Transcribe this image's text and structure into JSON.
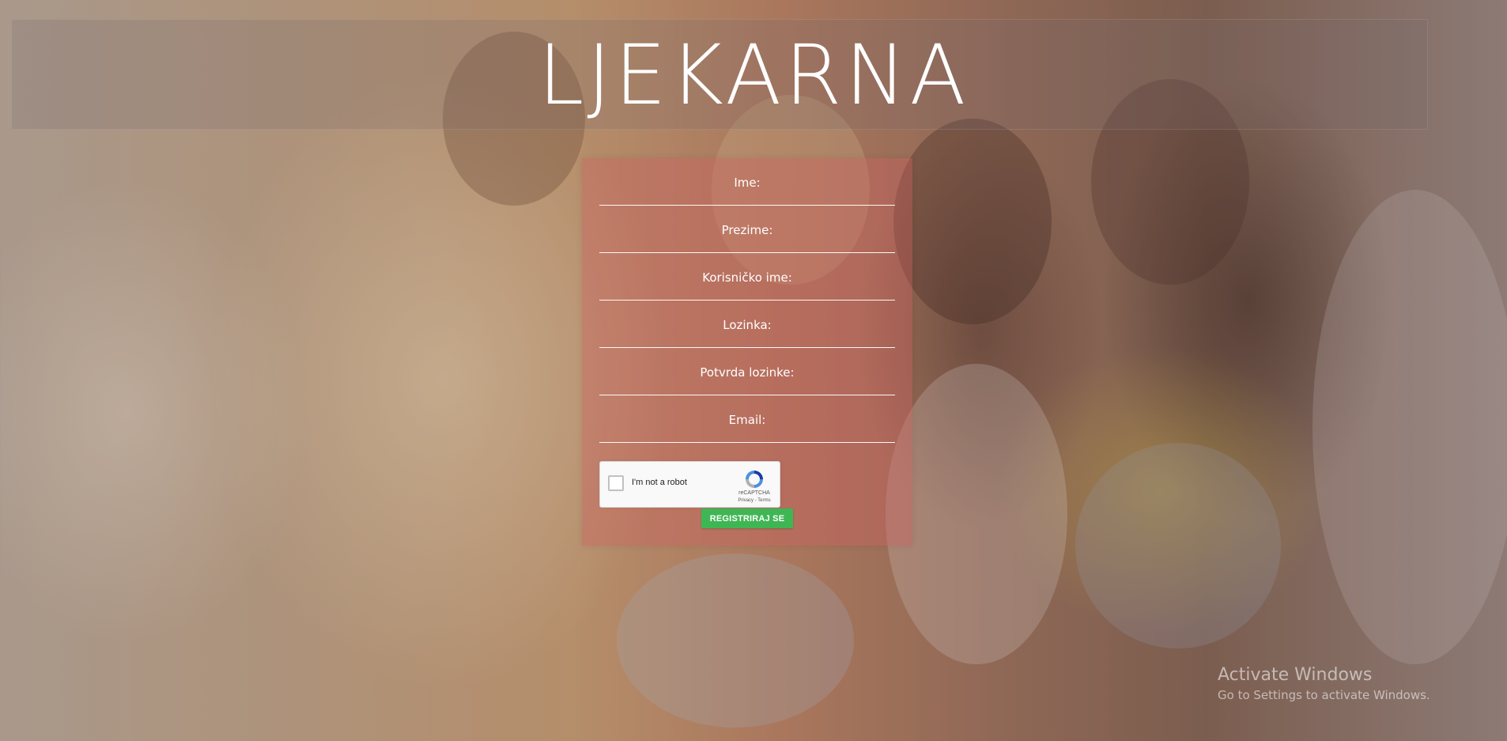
{
  "header": {
    "title": "LJEKARNA"
  },
  "form": {
    "fields": [
      {
        "label": "Ime:",
        "value": ""
      },
      {
        "label": "Prezime:",
        "value": ""
      },
      {
        "label": "Korisničko ime:",
        "value": ""
      },
      {
        "label": "Lozinka:",
        "value": ""
      },
      {
        "label": "Potvrda lozinke:",
        "value": ""
      },
      {
        "label": "Email:",
        "value": ""
      }
    ],
    "recaptcha": {
      "label": "I'm not a robot",
      "brand": "reCAPTCHA",
      "links": "Privacy - Terms"
    },
    "submit_label": "REGISTRIRAJ SE"
  },
  "watermark": {
    "title": "Activate Windows",
    "subtitle": "Go to Settings to activate Windows."
  },
  "colors": {
    "submit_button": "#3fb654",
    "form_panel": "#cd5f5f",
    "title_text": "#ffffff"
  }
}
